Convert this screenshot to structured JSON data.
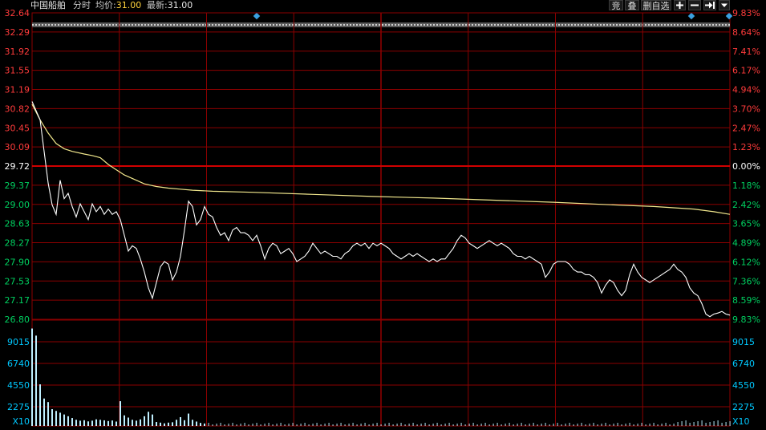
{
  "header": {
    "stock_name": "中国船舶",
    "mode": "分时",
    "avg_label": "均价:",
    "avg_value": "31.00",
    "last_label": "最新:",
    "last_value": "31.00"
  },
  "toolbar": {
    "auction_label": "竞",
    "overlay_label": "叠",
    "remove_watch_label": "删自选",
    "zoom_in_icon": "plus-icon",
    "zoom_out_icon": "minus-icon",
    "goto_icon": "arrow-right-bar-icon",
    "menu_icon": "dropdown-icon"
  },
  "colors": {
    "background": "#000000",
    "grid": "#8b0000",
    "prev_close_line": "#d00000",
    "price_line": "#ffffff",
    "avg_line": "#f0e68c",
    "up_text": "#ff3b3b",
    "down_text": "#00d060",
    "volume_bar": "#bfefff",
    "volume_axis": "#00c8ff",
    "neutral_text": "#ffffff"
  },
  "chart_data": {
    "type": "line",
    "title": "中国船舶 分时",
    "ylim": [
      26.8,
      32.64
    ],
    "prev_close": 29.72,
    "price_ticks": [
      "32.64",
      "32.29",
      "31.92",
      "31.55",
      "31.19",
      "30.82",
      "30.45",
      "30.09",
      "29.72",
      "29.37",
      "29.00",
      "28.63",
      "28.27",
      "27.90",
      "27.53",
      "27.17",
      "26.80"
    ],
    "pct_ticks": [
      "9.83%",
      "8.64%",
      "7.41%",
      "6.17%",
      "4.94%",
      "3.70%",
      "2.47%",
      "1.23%",
      "0.00%",
      "1.18%",
      "2.42%",
      "3.65%",
      "4.89%",
      "6.12%",
      "7.36%",
      "8.59%",
      "9.83%"
    ],
    "pct_tick_sides": [
      "up",
      "up",
      "up",
      "up",
      "up",
      "up",
      "up",
      "up",
      "flat",
      "down",
      "down",
      "down",
      "down",
      "down",
      "down",
      "down",
      "down"
    ],
    "price_series": [
      [
        0,
        30.95
      ],
      [
        2,
        30.6
      ],
      [
        3,
        30.0
      ],
      [
        4,
        29.4
      ],
      [
        5,
        28.98
      ],
      [
        6,
        28.8
      ],
      [
        7,
        29.45
      ],
      [
        8,
        29.1
      ],
      [
        9,
        29.2
      ],
      [
        10,
        28.95
      ],
      [
        11,
        28.75
      ],
      [
        12,
        29.0
      ],
      [
        13,
        28.85
      ],
      [
        14,
        28.7
      ],
      [
        15,
        29.0
      ],
      [
        16,
        28.85
      ],
      [
        17,
        28.95
      ],
      [
        18,
        28.8
      ],
      [
        19,
        28.9
      ],
      [
        20,
        28.8
      ],
      [
        21,
        28.85
      ],
      [
        22,
        28.7
      ],
      [
        23,
        28.4
      ],
      [
        24,
        28.1
      ],
      [
        25,
        28.2
      ],
      [
        26,
        28.15
      ],
      [
        27,
        27.95
      ],
      [
        28,
        27.7
      ],
      [
        29,
        27.4
      ],
      [
        30,
        27.2
      ],
      [
        31,
        27.5
      ],
      [
        32,
        27.8
      ],
      [
        33,
        27.9
      ],
      [
        34,
        27.85
      ],
      [
        35,
        27.55
      ],
      [
        36,
        27.7
      ],
      [
        37,
        28.0
      ],
      [
        38,
        28.5
      ],
      [
        39,
        29.05
      ],
      [
        40,
        28.95
      ],
      [
        41,
        28.6
      ],
      [
        42,
        28.7
      ],
      [
        43,
        28.95
      ],
      [
        44,
        28.8
      ],
      [
        45,
        28.75
      ],
      [
        46,
        28.55
      ],
      [
        47,
        28.4
      ],
      [
        48,
        28.45
      ],
      [
        49,
        28.3
      ],
      [
        50,
        28.5
      ],
      [
        51,
        28.55
      ],
      [
        52,
        28.45
      ],
      [
        53,
        28.45
      ],
      [
        54,
        28.4
      ],
      [
        55,
        28.3
      ],
      [
        56,
        28.4
      ],
      [
        57,
        28.2
      ],
      [
        58,
        27.95
      ],
      [
        59,
        28.15
      ],
      [
        60,
        28.25
      ],
      [
        61,
        28.2
      ],
      [
        62,
        28.05
      ],
      [
        63,
        28.1
      ],
      [
        64,
        28.15
      ],
      [
        65,
        28.05
      ],
      [
        66,
        27.9
      ],
      [
        67,
        27.95
      ],
      [
        68,
        28.0
      ],
      [
        69,
        28.1
      ],
      [
        70,
        28.25
      ],
      [
        71,
        28.15
      ],
      [
        72,
        28.05
      ],
      [
        73,
        28.1
      ],
      [
        74,
        28.05
      ],
      [
        75,
        28.0
      ],
      [
        76,
        28.0
      ],
      [
        77,
        27.95
      ],
      [
        78,
        28.05
      ],
      [
        79,
        28.1
      ],
      [
        80,
        28.2
      ],
      [
        81,
        28.25
      ],
      [
        82,
        28.2
      ],
      [
        83,
        28.25
      ],
      [
        84,
        28.15
      ],
      [
        85,
        28.25
      ],
      [
        86,
        28.2
      ],
      [
        87,
        28.25
      ],
      [
        88,
        28.2
      ],
      [
        89,
        28.15
      ],
      [
        90,
        28.05
      ],
      [
        91,
        28.0
      ],
      [
        92,
        27.95
      ],
      [
        93,
        28.0
      ],
      [
        94,
        28.05
      ],
      [
        95,
        28.0
      ],
      [
        96,
        28.05
      ],
      [
        97,
        28.0
      ],
      [
        98,
        27.95
      ],
      [
        99,
        27.9
      ],
      [
        100,
        27.95
      ],
      [
        101,
        27.9
      ],
      [
        102,
        27.95
      ],
      [
        103,
        27.95
      ],
      [
        104,
        28.05
      ],
      [
        105,
        28.15
      ],
      [
        106,
        28.3
      ],
      [
        107,
        28.4
      ],
      [
        108,
        28.35
      ],
      [
        109,
        28.25
      ],
      [
        110,
        28.2
      ],
      [
        111,
        28.15
      ],
      [
        112,
        28.2
      ],
      [
        113,
        28.25
      ],
      [
        114,
        28.3
      ],
      [
        115,
        28.25
      ],
      [
        116,
        28.2
      ],
      [
        117,
        28.25
      ],
      [
        118,
        28.2
      ],
      [
        119,
        28.15
      ],
      [
        120,
        28.05
      ],
      [
        121,
        28.0
      ],
      [
        122,
        28.0
      ],
      [
        123,
        27.95
      ],
      [
        124,
        28.0
      ],
      [
        125,
        27.95
      ],
      [
        126,
        27.9
      ],
      [
        127,
        27.85
      ],
      [
        128,
        27.6
      ],
      [
        129,
        27.7
      ],
      [
        130,
        27.85
      ],
      [
        131,
        27.9
      ],
      [
        132,
        27.9
      ],
      [
        133,
        27.9
      ],
      [
        134,
        27.85
      ],
      [
        135,
        27.75
      ],
      [
        136,
        27.7
      ],
      [
        137,
        27.7
      ],
      [
        138,
        27.65
      ],
      [
        139,
        27.65
      ],
      [
        140,
        27.6
      ],
      [
        141,
        27.5
      ],
      [
        142,
        27.3
      ],
      [
        143,
        27.45
      ],
      [
        144,
        27.55
      ],
      [
        145,
        27.5
      ],
      [
        146,
        27.35
      ],
      [
        147,
        27.25
      ],
      [
        148,
        27.35
      ],
      [
        149,
        27.65
      ],
      [
        150,
        27.85
      ],
      [
        151,
        27.7
      ],
      [
        152,
        27.6
      ],
      [
        153,
        27.55
      ],
      [
        154,
        27.5
      ],
      [
        155,
        27.55
      ],
      [
        156,
        27.6
      ],
      [
        157,
        27.65
      ],
      [
        158,
        27.7
      ],
      [
        159,
        27.75
      ],
      [
        160,
        27.85
      ],
      [
        161,
        27.75
      ],
      [
        162,
        27.7
      ],
      [
        163,
        27.6
      ],
      [
        164,
        27.4
      ],
      [
        165,
        27.3
      ],
      [
        166,
        27.25
      ],
      [
        167,
        27.1
      ],
      [
        168,
        26.9
      ],
      [
        169,
        26.85
      ],
      [
        170,
        26.9
      ],
      [
        171,
        26.92
      ],
      [
        172,
        26.95
      ],
      [
        173,
        26.9
      ],
      [
        174,
        26.88
      ]
    ],
    "avg_series": [
      [
        0,
        30.9
      ],
      [
        2,
        30.6
      ],
      [
        4,
        30.35
      ],
      [
        6,
        30.15
      ],
      [
        8,
        30.05
      ],
      [
        10,
        30.0
      ],
      [
        13,
        29.95
      ],
      [
        15,
        29.92
      ],
      [
        17,
        29.88
      ],
      [
        19,
        29.75
      ],
      [
        21,
        29.65
      ],
      [
        23,
        29.55
      ],
      [
        26,
        29.45
      ],
      [
        28,
        29.38
      ],
      [
        31,
        29.33
      ],
      [
        34,
        29.3
      ],
      [
        37,
        29.28
      ],
      [
        40,
        29.26
      ],
      [
        45,
        29.24
      ],
      [
        55,
        29.22
      ],
      [
        70,
        29.18
      ],
      [
        85,
        29.14
      ],
      [
        100,
        29.11
      ],
      [
        115,
        29.07
      ],
      [
        130,
        29.03
      ],
      [
        145,
        28.98
      ],
      [
        155,
        28.95
      ],
      [
        165,
        28.9
      ],
      [
        170,
        28.85
      ],
      [
        174,
        28.8
      ]
    ],
    "volume_ticks": [
      "9015",
      "6740",
      "4550",
      "2275",
      "X10"
    ],
    "volume_max": 11500,
    "volume_series": [
      [
        0,
        11000
      ],
      [
        1,
        10200
      ],
      [
        2,
        4700
      ],
      [
        3,
        3100
      ],
      [
        4,
        2700
      ],
      [
        5,
        1900
      ],
      [
        6,
        1700
      ],
      [
        7,
        1500
      ],
      [
        8,
        1300
      ],
      [
        9,
        1100
      ],
      [
        10,
        900
      ],
      [
        11,
        700
      ],
      [
        12,
        600
      ],
      [
        13,
        650
      ],
      [
        14,
        520
      ],
      [
        15,
        600
      ],
      [
        16,
        750
      ],
      [
        17,
        700
      ],
      [
        18,
        640
      ],
      [
        19,
        560
      ],
      [
        20,
        620
      ],
      [
        21,
        500
      ],
      [
        22,
        2800
      ],
      [
        23,
        1200
      ],
      [
        24,
        950
      ],
      [
        25,
        700
      ],
      [
        26,
        600
      ],
      [
        27,
        750
      ],
      [
        28,
        1100
      ],
      [
        29,
        1600
      ],
      [
        30,
        1300
      ],
      [
        31,
        450
      ],
      [
        32,
        380
      ],
      [
        33,
        300
      ],
      [
        34,
        380
      ],
      [
        35,
        420
      ],
      [
        36,
        700
      ],
      [
        37,
        1000
      ],
      [
        38,
        650
      ],
      [
        39,
        1400
      ],
      [
        40,
        700
      ],
      [
        41,
        500
      ],
      [
        42,
        350
      ],
      [
        43,
        280
      ]
    ]
  }
}
